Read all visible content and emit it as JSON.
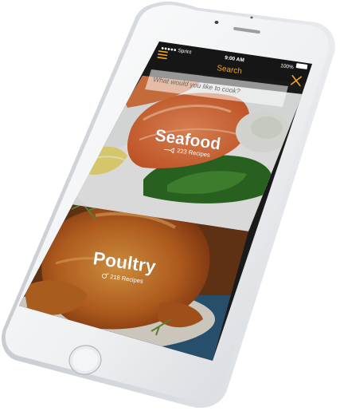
{
  "status_bar": {
    "carrier": "●●●●● Sprint",
    "time": "9:00 AM",
    "battery": "100%"
  },
  "header": {
    "title": "Search",
    "accent_color": "#f0a428",
    "menu_icon": "hamburger-menu-icon",
    "close_icon": "close-icon"
  },
  "search": {
    "placeholder": "What would you like to cook?"
  },
  "categories": [
    {
      "name": "Seafood",
      "count": "223 Recipes",
      "icon": "fish-icon"
    },
    {
      "name": "Poultry",
      "count": "218 Recipes",
      "icon": "chicken-icon"
    }
  ],
  "device": {
    "body_color": "#eef0f2",
    "frame_color": "#d2d5d9"
  }
}
